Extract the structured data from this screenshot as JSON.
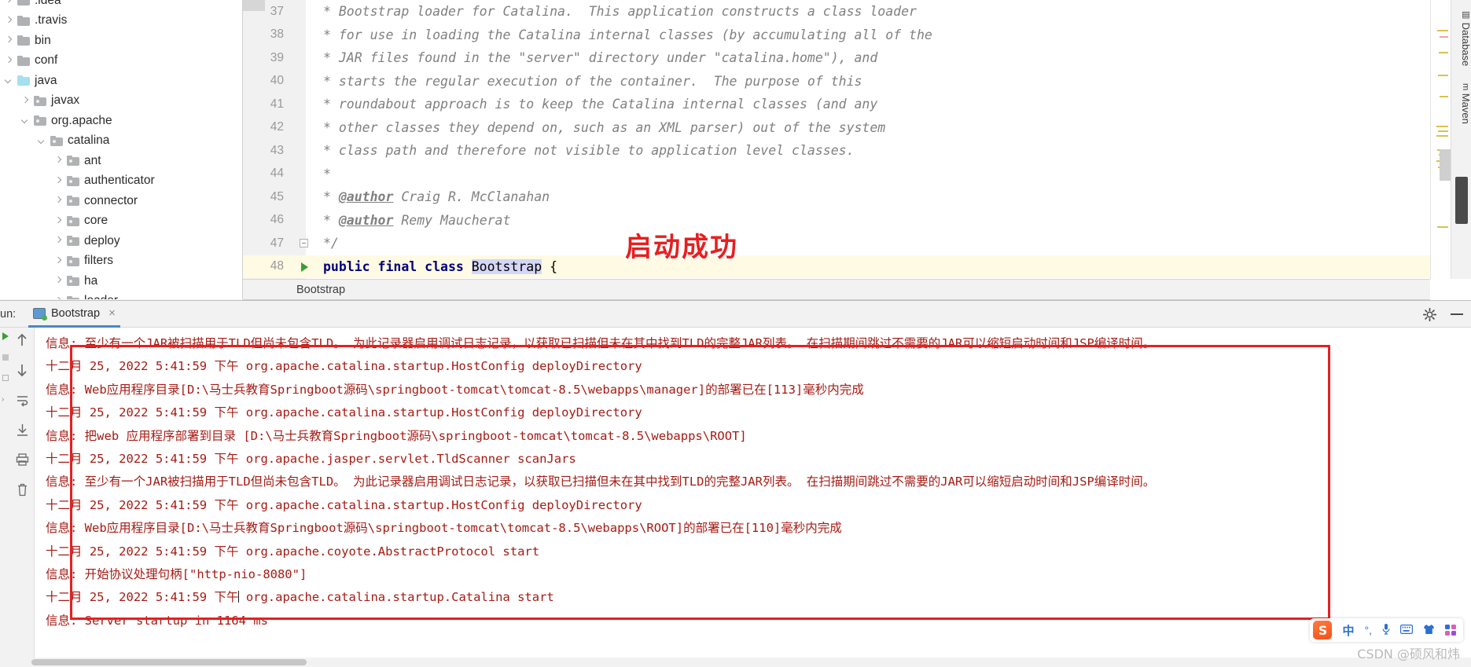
{
  "project_tree": {
    "items": [
      {
        "label": ".idea",
        "indent": 0,
        "arrow": "right",
        "icon": "folder"
      },
      {
        "label": ".travis",
        "indent": 0,
        "arrow": "right",
        "icon": "folder"
      },
      {
        "label": "bin",
        "indent": 0,
        "arrow": "right",
        "icon": "folder"
      },
      {
        "label": "conf",
        "indent": 0,
        "arrow": "right",
        "icon": "folder"
      },
      {
        "label": "java",
        "indent": 0,
        "arrow": "down",
        "icon": "folder-source"
      },
      {
        "label": "javax",
        "indent": 1,
        "arrow": "right",
        "icon": "package"
      },
      {
        "label": "org.apache",
        "indent": 1,
        "arrow": "down",
        "icon": "package"
      },
      {
        "label": "catalina",
        "indent": 2,
        "arrow": "down",
        "icon": "package"
      },
      {
        "label": "ant",
        "indent": 3,
        "arrow": "right",
        "icon": "package"
      },
      {
        "label": "authenticator",
        "indent": 3,
        "arrow": "right",
        "icon": "package"
      },
      {
        "label": "connector",
        "indent": 3,
        "arrow": "right",
        "icon": "package"
      },
      {
        "label": "core",
        "indent": 3,
        "arrow": "right",
        "icon": "package"
      },
      {
        "label": "deploy",
        "indent": 3,
        "arrow": "right",
        "icon": "package"
      },
      {
        "label": "filters",
        "indent": 3,
        "arrow": "right",
        "icon": "package"
      },
      {
        "label": "ha",
        "indent": 3,
        "arrow": "right",
        "icon": "package"
      },
      {
        "label": "loader",
        "indent": 3,
        "arrow": "right",
        "icon": "package"
      }
    ]
  },
  "editor": {
    "lines": [
      {
        "num": "37",
        "text": "* Bootstrap loader for Catalina.  This application constructs a class loader",
        "kind": "comment"
      },
      {
        "num": "38",
        "text": "* for use in loading the Catalina internal classes (by accumulating all of the",
        "kind": "comment"
      },
      {
        "num": "39",
        "text": "* JAR files found in the \"server\" directory under \"catalina.home\"), and",
        "kind": "comment"
      },
      {
        "num": "40",
        "text": "* starts the regular execution of the container.  The purpose of this",
        "kind": "comment"
      },
      {
        "num": "41",
        "text": "* roundabout approach is to keep the Catalina internal classes (and any",
        "kind": "comment"
      },
      {
        "num": "42",
        "text": "* other classes they depend on, such as an XML parser) out of the system",
        "kind": "comment"
      },
      {
        "num": "43",
        "text": "* class path and therefore not visible to application level classes.",
        "kind": "comment"
      },
      {
        "num": "44",
        "text": "*",
        "kind": "comment"
      },
      {
        "num": "45",
        "text": "* @author Craig R. McClanahan",
        "kind": "author",
        "tag": "@author",
        "rest": " Craig R. McClanahan"
      },
      {
        "num": "46",
        "text": "* @author Remy Maucherat",
        "kind": "author",
        "tag": "@author",
        "rest": " Remy Maucherat"
      },
      {
        "num": "47",
        "text": "*/",
        "kind": "comment-end"
      },
      {
        "num": "48",
        "text": "public final class Bootstrap {",
        "kind": "code",
        "keywords": "public final class",
        "classname": "Bootstrap",
        "brace": " {"
      }
    ]
  },
  "breadcrumb": {
    "label": "Bootstrap"
  },
  "right_tool_tabs": [
    {
      "label": "Database"
    },
    {
      "label": "Maven"
    }
  ],
  "run_window": {
    "run_label": "un:",
    "tab_label": "Bootstrap",
    "close_label": "×",
    "settings_tooltip": "gear",
    "side_tools": [
      "rerun",
      "scroll-up",
      "scroll-down",
      "soft-wrap",
      "print",
      "clear-all"
    ],
    "console_lines": [
      "信息: 至少有一个JAR被扫描用于TLD但尚未包含TLD。  为此记录器启用调试日志记录，以获取已扫描但未在其中找到TLD的完整JAR列表。  在扫描期间跳过不需要的JAR可以缩短启动时间和JSP编译时间。",
      "十二月 25, 2022 5:41:59 下午 org.apache.catalina.startup.HostConfig deployDirectory",
      "信息: Web应用程序目录[D:\\马士兵教育Springboot源码\\springboot-tomcat\\tomcat-8.5\\webapps\\manager]的部署已在[113]毫秒内完成",
      "十二月 25, 2022 5:41:59 下午 org.apache.catalina.startup.HostConfig deployDirectory",
      "信息: 把web 应用程序部署到目录 [D:\\马士兵教育Springboot源码\\springboot-tomcat\\tomcat-8.5\\webapps\\ROOT]",
      "十二月 25, 2022 5:41:59 下午 org.apache.jasper.servlet.TldScanner scanJars",
      "信息: 至少有一个JAR被扫描用于TLD但尚未包含TLD。  为此记录器启用调试日志记录，以获取已扫描但未在其中找到TLD的完整JAR列表。  在扫描期间跳过不需要的JAR可以缩短启动时间和JSP编译时间。",
      "十二月 25, 2022 5:41:59 下午 org.apache.catalina.startup.HostConfig deployDirectory",
      "信息: Web应用程序目录[D:\\马士兵教育Springboot源码\\springboot-tomcat\\tomcat-8.5\\webapps\\ROOT]的部署已在[110]毫秒内完成",
      "十二月 25, 2022 5:41:59 下午 org.apache.coyote.AbstractProtocol start",
      "信息: 开始协议处理句柄[\"http-nio-8080\"]",
      "十二月 25, 2022 5:41:59 下午 org.apache.catalina.startup.Catalina start",
      "信息: Server startup in 1164 ms"
    ]
  },
  "annotation": {
    "success_text": "启动成功",
    "success_color": "#e81f1f",
    "rect_color": "#e81f1f"
  },
  "ime_bar": {
    "logo": "S",
    "mode": "中",
    "icons": [
      "punctuation-icon",
      "microphone-icon",
      "keyboard-icon",
      "skin-icon",
      "apps-icon"
    ]
  },
  "watermark": {
    "text": "CSDN @硕风和炜"
  }
}
